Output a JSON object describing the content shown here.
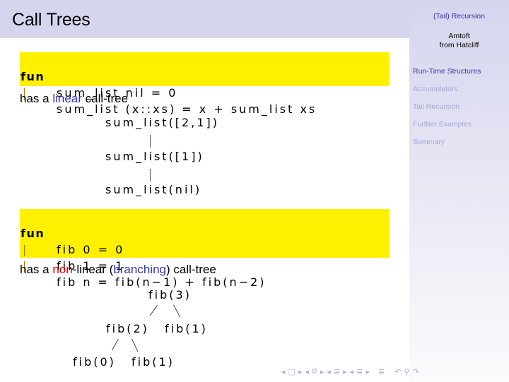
{
  "header": {
    "title": "Call Trees"
  },
  "sidebar": {
    "deck_title": "(Tail) Recursion",
    "author_line1": "Amtoft",
    "author_line2": "from Hatcliff",
    "items": [
      {
        "label": "Run-Time Structures",
        "active": true
      },
      {
        "label": "Accumulators",
        "active": false
      },
      {
        "label": "Tail Recursion",
        "active": false
      },
      {
        "label": "Further Examples",
        "active": false
      },
      {
        "label": "Summary",
        "active": false
      }
    ]
  },
  "code1": {
    "lines": [
      {
        "prefix": "fun",
        "code": "sum_list nil = 0"
      },
      {
        "prefix": "|",
        "code": "sum_list (x::xs) = x + sum_list xs"
      }
    ]
  },
  "prose1": {
    "before": "has a ",
    "highlight": "linear",
    "after": " call-tree"
  },
  "tree1": {
    "nodes": [
      "sum_list([2,1])",
      "sum_list([1])",
      "sum_list(nil)"
    ]
  },
  "code2": {
    "lines": [
      {
        "prefix": "fun",
        "code": "fib 0 = 0"
      },
      {
        "prefix": "|",
        "code": "fib 1 = 1"
      },
      {
        "prefix": "|",
        "code": "fib n = fib(n−1) + fib(n−2)"
      }
    ]
  },
  "prose2": {
    "before": "has a ",
    "red": "non",
    "middle": "-linear (",
    "blue": "branching",
    "after": ") call-tree"
  },
  "tree2": {
    "root": "fib(3)",
    "left": "fib(2)",
    "right": "fib(1)",
    "left_left": "fib(0)",
    "left_right": "fib(1)"
  },
  "navbar": {
    "icons": [
      "frame-prev",
      "frame-icon",
      "frame-next",
      "subsection-prev",
      "subsection-icon",
      "subsection-next",
      "section-prev",
      "section-icon",
      "section-next",
      "doc-icon",
      "undo-icon",
      "search-icon",
      "redo-icon"
    ]
  }
}
